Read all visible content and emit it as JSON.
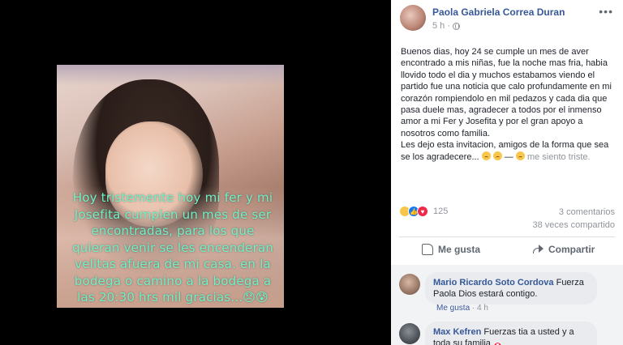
{
  "photo": {
    "overlay_text": "Hoy tristemente hoy mi fer y mi Josefita cumplen un mes de ser encontradas, para los que quieran venir se les encenderan velitas afuera de mi casa. en la bodega o camino a la bodega a las 20:30 hrs mil gracias...😞😰"
  },
  "post": {
    "author": "Paola Gabriela Correa Duran",
    "time": "5 h",
    "visibility_icon": "globe-icon",
    "body": "Buenos dias, hoy 24 se cumple un mes de aver encontrado a mis niñas, fue la noche mas fria, habia llovido todo el dia y muchos estabamos viendo el partido fue una noticia que calo profundamente en mi corazón rompiendolo en mil pedazos y cada dia que pasa duele mas, agradecer a todos por el inmenso amor a mi Fer y Josefita y por el gran apoyo a nosotros como familia.",
    "body2": "Les dejo esta invitacion, amigos de la forma que sea se los agradecere...",
    "feeling_dash": " — ",
    "feeling": "me siento triste.",
    "reactions_count": "125",
    "comments_count": "3 comentarios",
    "shares_count": "38 veces compartido",
    "like_label": "Me gusta",
    "share_label": "Compartir"
  },
  "comments": [
    {
      "name": "Mario Ricardo Soto Cordova",
      "text": "Fuerza Paola Dios estará contigo.",
      "like_label": "Me gusta",
      "time": "4 h"
    },
    {
      "name": "Max Kefren",
      "text": "Fuerzas tia a usted y a toda su familia"
    }
  ],
  "colors": {
    "link_blue": "#365899",
    "overlay_text": "#6ef3c8"
  }
}
